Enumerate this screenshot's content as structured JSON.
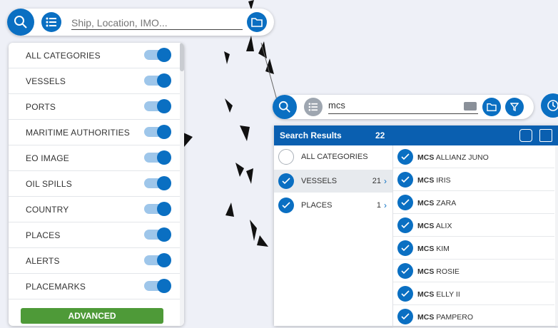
{
  "search": {
    "placeholder": "Ship, Location, IMO..."
  },
  "categories": [
    {
      "label": "ALL CATEGORIES",
      "on": true
    },
    {
      "label": "VESSELS",
      "on": true
    },
    {
      "label": "PORTS",
      "on": true
    },
    {
      "label": "MARITIME AUTHORITIES",
      "on": true
    },
    {
      "label": "EO IMAGE",
      "on": true
    },
    {
      "label": "OIL SPILLS",
      "on": true
    },
    {
      "label": "COUNTRY",
      "on": true
    },
    {
      "label": "PLACES",
      "on": true
    },
    {
      "label": "ALERTS",
      "on": true
    },
    {
      "label": "PLACEMARKS",
      "on": true
    }
  ],
  "advanced_label": "ADVANCED",
  "search2": {
    "query": "mcs"
  },
  "results": {
    "title": "Search Results",
    "count": "22",
    "categories": [
      {
        "label": "ALL CATEGORIES",
        "count": "",
        "checked": false
      },
      {
        "label": "VESSELS",
        "count": "21",
        "checked": true
      },
      {
        "label": "PLACES",
        "count": "1",
        "checked": true
      }
    ],
    "vessels": [
      {
        "prefix": "MCS",
        "name": "ALLIANZ JUNO"
      },
      {
        "prefix": "MCS",
        "name": "IRIS"
      },
      {
        "prefix": "MCS",
        "name": "ZARA"
      },
      {
        "prefix": "MCS",
        "name": "ALIX"
      },
      {
        "prefix": "MCS",
        "name": "KIM"
      },
      {
        "prefix": "MCS",
        "name": "ROSIE"
      },
      {
        "prefix": "MCS",
        "name": "ELLY II"
      },
      {
        "prefix": "MCS",
        "name": "PAMPERO"
      }
    ]
  },
  "colors": {
    "accent": "#0a6fc2",
    "header": "#0a5fb0",
    "advanced": "#4e9a38"
  }
}
